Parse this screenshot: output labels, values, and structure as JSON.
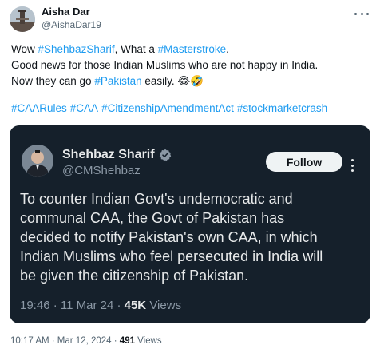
{
  "author": {
    "name": "Aisha Dar",
    "handle": "@AishaDar19"
  },
  "tweet": {
    "lines": [
      [
        {
          "text": "Wow ",
          "link": false
        },
        {
          "text": "#ShehbazSharif",
          "link": true
        },
        {
          "text": ", What a ",
          "link": false
        },
        {
          "text": "#Masterstroke",
          "link": true
        },
        {
          "text": ".",
          "link": false
        }
      ],
      [
        {
          "text": "Good news for those Indian Muslims who are not happy in India.",
          "link": false
        }
      ],
      [
        {
          "text": "Now they can go ",
          "link": false
        },
        {
          "text": "#Pakistan",
          "link": true
        },
        {
          "text": " easily. 😂🤣",
          "link": false
        }
      ]
    ],
    "hashtags": [
      "#CAARules",
      "#CAA",
      "#CitizenshipAmendmentAct",
      "#stockmarketcrash"
    ]
  },
  "quoted": {
    "name": "Shehbaz Sharif",
    "handle": "@CMShehbaz",
    "follow_label": "Follow",
    "text_lines": [
      "To counter Indian Govt's undemocratic and",
      "communal CAA, the Govt of Pakistan has",
      "decided to notify Pakistan's own CAA, in which",
      "Indian Muslims who feel persecuted in India will",
      "be given the citizenship of Pakistan."
    ],
    "time": "19:46 · 11 Mar 24 · ",
    "views_count": "45K",
    "views_label": " Views"
  },
  "meta": {
    "time": "10:17 AM · Mar 12, 2024 · ",
    "views_count": "491",
    "views_label": " Views"
  },
  "colors": {
    "link": "#1d9bf0",
    "card_bg": "#15202b",
    "verified": "#8b98a5"
  },
  "icons": {
    "more": "more-horizontal-icon",
    "verified": "verified-badge-icon"
  }
}
